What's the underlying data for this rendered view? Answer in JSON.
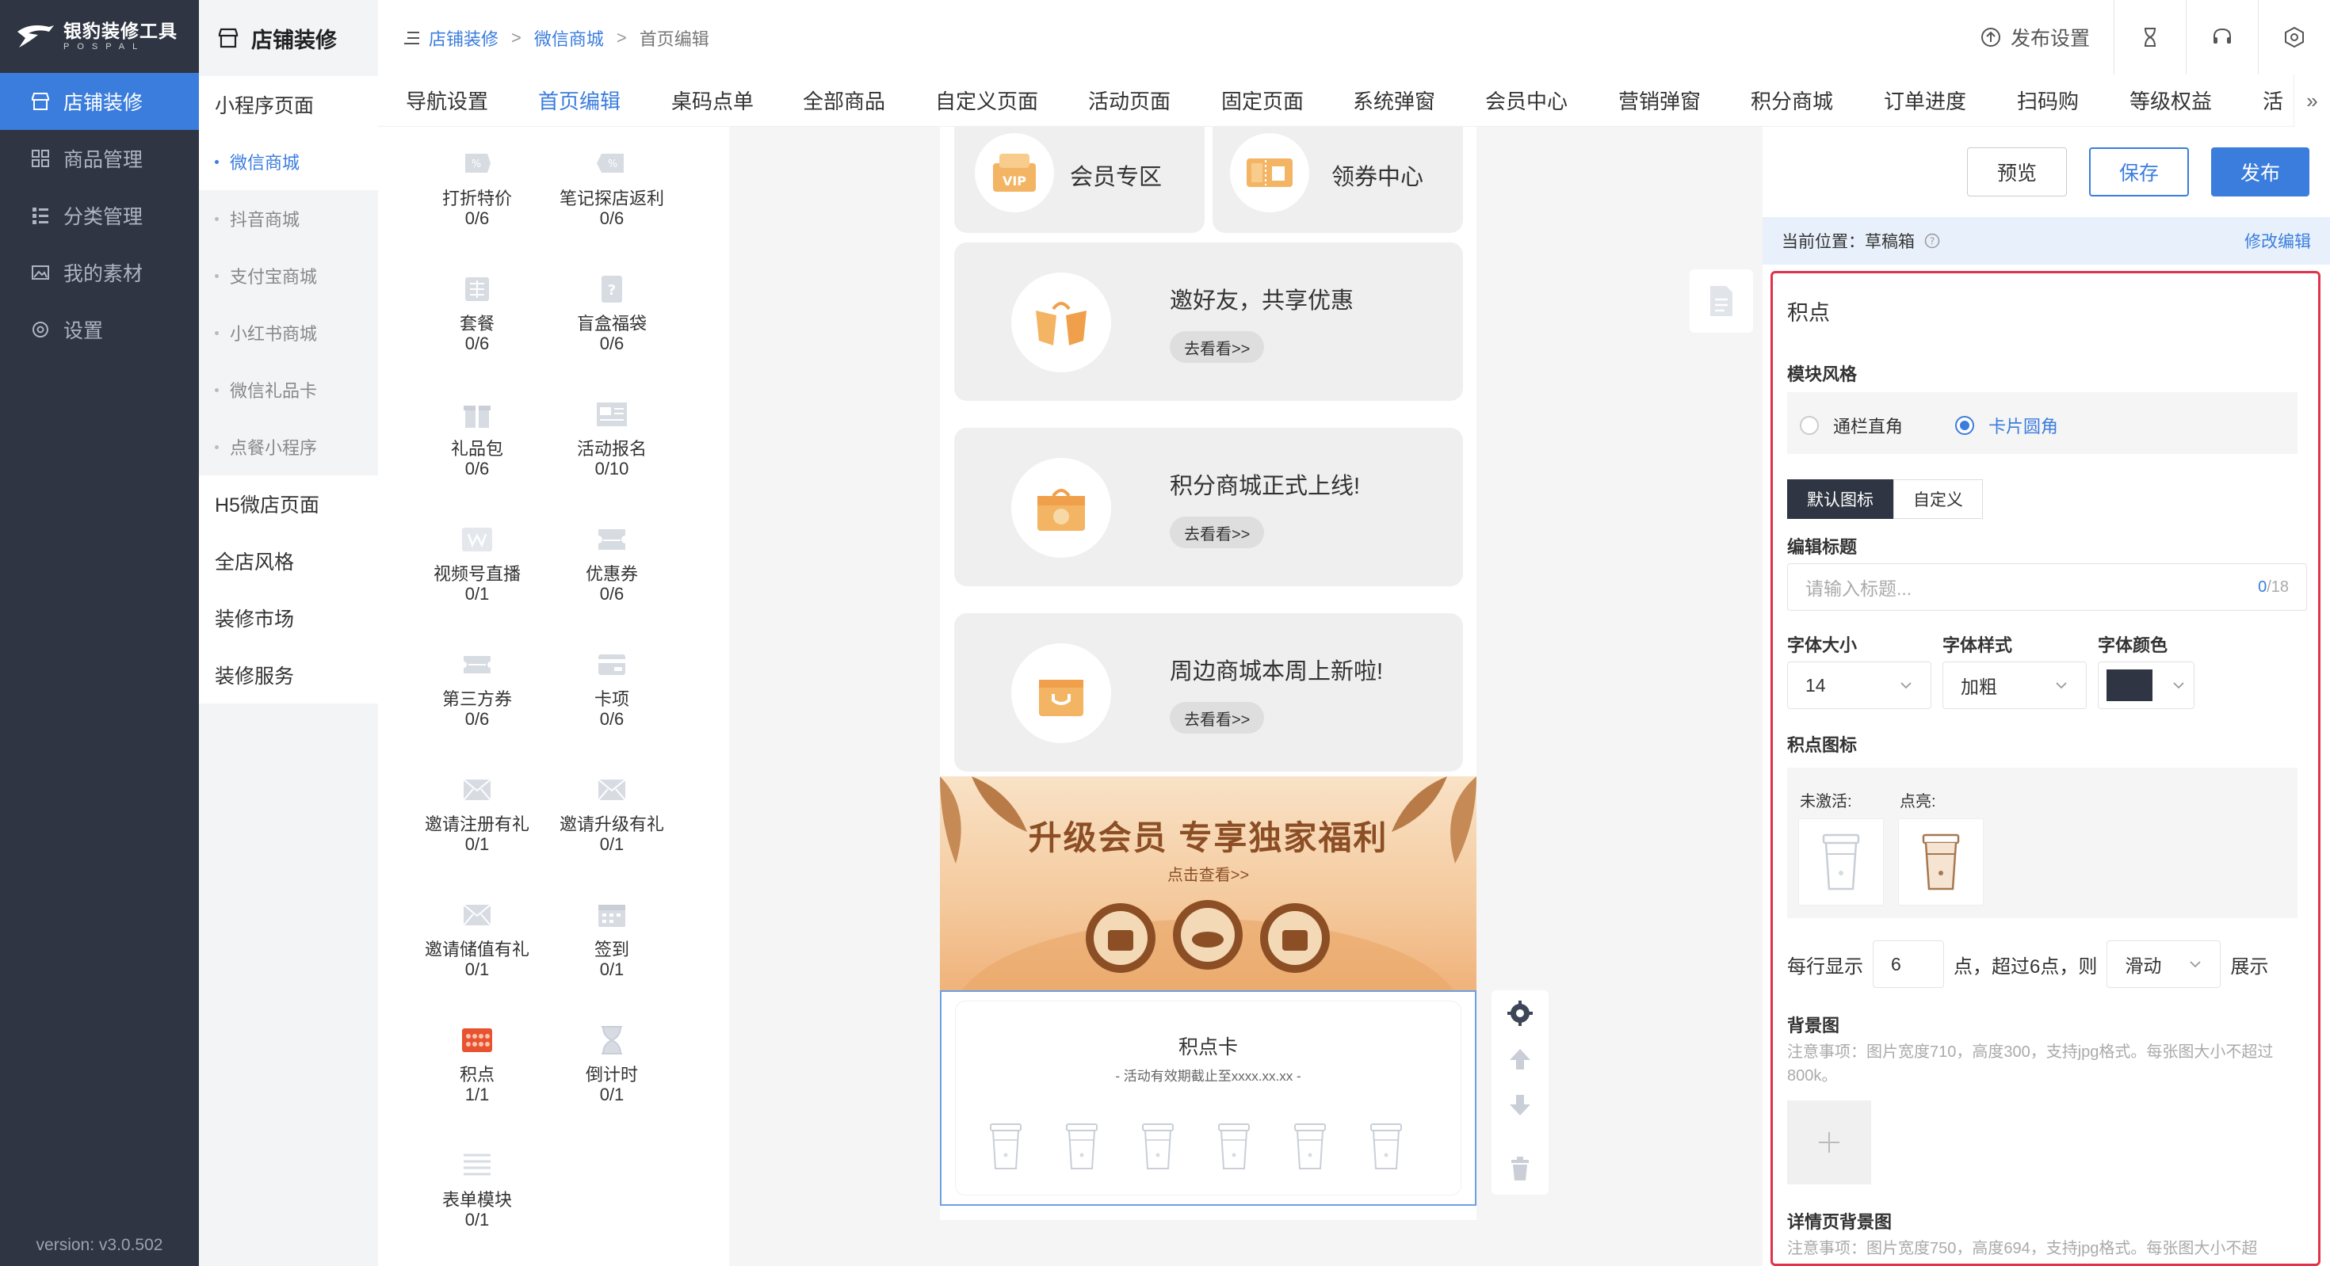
{
  "app": {
    "logo_title": "银豹装修工具",
    "logo_sub": "POSPAL",
    "version": "version: v3.0.502"
  },
  "sidebar": {
    "items": [
      {
        "label": "店铺装修",
        "icon": "store-icon",
        "active": true
      },
      {
        "label": "商品管理",
        "icon": "grid-icon"
      },
      {
        "label": "分类管理",
        "icon": "list-icon"
      },
      {
        "label": "我的素材",
        "icon": "image-icon"
      },
      {
        "label": "设置",
        "icon": "gear-icon"
      }
    ]
  },
  "subnav": {
    "title": "店铺装修",
    "group1": "小程序页面",
    "subitems": [
      "微信商城",
      "抖音商城",
      "支付宝商城",
      "小红书商城",
      "微信礼品卡",
      "点餐小程序"
    ],
    "groups": [
      "H5微店页面",
      "全店风格",
      "装修市场",
      "装修服务"
    ]
  },
  "breadcrumb": {
    "root": "店铺装修",
    "mid": "微信商城",
    "current": "首页编辑",
    "sep": ">"
  },
  "toolbar": {
    "publish_settings": "发布设置"
  },
  "tabs": [
    "导航设置",
    "首页编辑",
    "桌码点单",
    "全部商品",
    "自定义页面",
    "活动页面",
    "固定页面",
    "系统弹窗",
    "会员中心",
    "营销弹窗",
    "积分商城",
    "订单进度",
    "扫码购",
    "等级权益",
    "活"
  ],
  "tabs_more": "»",
  "palette": [
    {
      "name": "打折特价",
      "count": "0/6",
      "icon": "discount-tag-icon"
    },
    {
      "name": "笔记探店返利",
      "count": "0/6",
      "icon": "note-rebate-icon"
    },
    {
      "name": "套餐",
      "count": "0/6",
      "icon": "combo-icon"
    },
    {
      "name": "盲盒福袋",
      "count": "0/6",
      "icon": "mystery-box-icon"
    },
    {
      "name": "礼品包",
      "count": "0/6",
      "icon": "gift-icon"
    },
    {
      "name": "活动报名",
      "count": "0/10",
      "icon": "signup-icon"
    },
    {
      "name": "视频号直播",
      "count": "0/1",
      "icon": "video-live-icon"
    },
    {
      "name": "优惠券",
      "count": "0/6",
      "icon": "coupon-icon"
    },
    {
      "name": "第三方券",
      "count": "0/6",
      "icon": "third-party-coupon-icon"
    },
    {
      "name": "卡项",
      "count": "0/6",
      "icon": "card-icon"
    },
    {
      "name": "邀请注册有礼",
      "count": "0/1",
      "icon": "invite-register-icon"
    },
    {
      "name": "邀请升级有礼",
      "count": "0/1",
      "icon": "invite-upgrade-icon"
    },
    {
      "name": "邀请储值有礼",
      "count": "0/1",
      "icon": "invite-deposit-icon"
    },
    {
      "name": "签到",
      "count": "0/1",
      "icon": "checkin-icon"
    },
    {
      "name": "积点",
      "count": "1/1",
      "icon": "points-icon"
    },
    {
      "name": "倒计时",
      "count": "0/1",
      "icon": "countdown-icon"
    },
    {
      "name": "表单模块",
      "count": "0/1",
      "icon": "form-icon"
    }
  ],
  "phone": {
    "top_cards": [
      {
        "label": "会员专区"
      },
      {
        "label": "领券中心"
      }
    ],
    "promos": [
      {
        "title": "邀好友，共享优惠",
        "button": "去看看>>"
      },
      {
        "title": "积分商城正式上线!",
        "button": "去看看>>"
      },
      {
        "title": "周边商城本周上新啦!",
        "button": "去看看>>"
      }
    ],
    "banner": {
      "title": "升级会员  专享独家福利",
      "sub": "点击查看>>"
    },
    "points_card": {
      "title": "积点卡",
      "subtitle": "- 活动有效期截止至xxxx.xx.xx -",
      "cups": 6
    }
  },
  "actions": {
    "preview": "预览",
    "save": "保存",
    "publish": "发布"
  },
  "location": {
    "label": "当前位置：草稿箱",
    "edit": "修改编辑"
  },
  "settings": {
    "title": "积点",
    "style_label": "模块风格",
    "style_options": [
      "通栏直角",
      "卡片圆角"
    ],
    "style_selected": 1,
    "icon_mode": [
      "默认图标",
      "自定义"
    ],
    "title_label": "编辑标题",
    "title_placeholder": "请输入标题...",
    "title_count": "0",
    "title_max": "/18",
    "font_size_label": "字体大小",
    "font_size_value": "14",
    "font_style_label": "字体样式",
    "font_style_value": "加粗",
    "font_color_label": "字体颜色",
    "font_color_value": "#2f3542",
    "points_icon_label": "积点图标",
    "inactive_label": "未激活:",
    "active_label": "点亮:",
    "per_row_prefix": "每行显示",
    "per_row_value": "6",
    "per_row_mid": "点，超过6点，则",
    "overflow_value": "滑动",
    "per_row_suffix": "展示",
    "bg_label": "背景图",
    "bg_note": "注意事项：图片宽度710，高度300，支持jpg格式。每张图大小不超过800k。",
    "detail_bg_label": "详情页背景图",
    "detail_bg_note": "注意事项：图片宽度750，高度694，支持jpg格式。每张图大小不超"
  },
  "colors": {
    "accent": "#3b7ddd",
    "sidebar": "#2f3542",
    "highlight_border": "#e0334a",
    "banner_text": "#8c4e25"
  }
}
